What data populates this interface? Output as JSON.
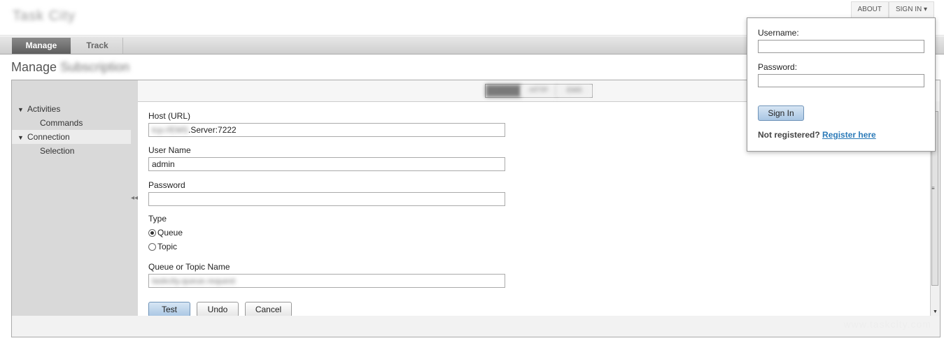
{
  "header": {
    "logo": "Task City"
  },
  "top_links": {
    "about": "ABOUT",
    "sign_in": "SIGN IN ▾"
  },
  "tabs": [
    {
      "label": "Manage",
      "active": true
    },
    {
      "label": "Track",
      "active": false
    }
  ],
  "page_title": {
    "prefix": "Manage",
    "blurred": "Subscription"
  },
  "sidebar": {
    "items": [
      {
        "label": "Activities",
        "level": 0,
        "expanded": true
      },
      {
        "label": "Commands",
        "level": 1
      },
      {
        "label": "Connection",
        "level": 0,
        "expanded": true,
        "selected": true
      },
      {
        "label": "Selection",
        "level": 1
      }
    ],
    "collapse_glyph": "◂◂"
  },
  "toolbar": {
    "toggles": [
      "JMS",
      "HTTP",
      "EMS"
    ]
  },
  "form": {
    "host": {
      "label": "Host (URL)",
      "value_blurred": "tcp://EMS",
      "value": ".Server:7222"
    },
    "user_name": {
      "label": "User Name",
      "value": "admin"
    },
    "password": {
      "label": "Password",
      "value": ""
    },
    "type": {
      "label": "Type",
      "options": [
        {
          "label": "Queue",
          "checked": true
        },
        {
          "label": "Topic",
          "checked": false
        }
      ]
    },
    "queue_topic": {
      "label": "Queue or Topic Name",
      "value_blurred": "taskcity.queue.request"
    },
    "buttons": {
      "test": "Test",
      "undo": "Undo",
      "cancel": "Cancel"
    }
  },
  "footer": {
    "watermark": "www.taskcity.com"
  },
  "signin_popup": {
    "username_label": "Username:",
    "password_label": "Password:",
    "button": "Sign In",
    "not_registered": "Not registered?",
    "register_link": "Register here"
  },
  "colors": {
    "accent_button": "#a9c6e3",
    "active_tab": "#5e5e5e",
    "sidebar_bg": "#d9d9d9",
    "link": "#2b7ab8"
  }
}
